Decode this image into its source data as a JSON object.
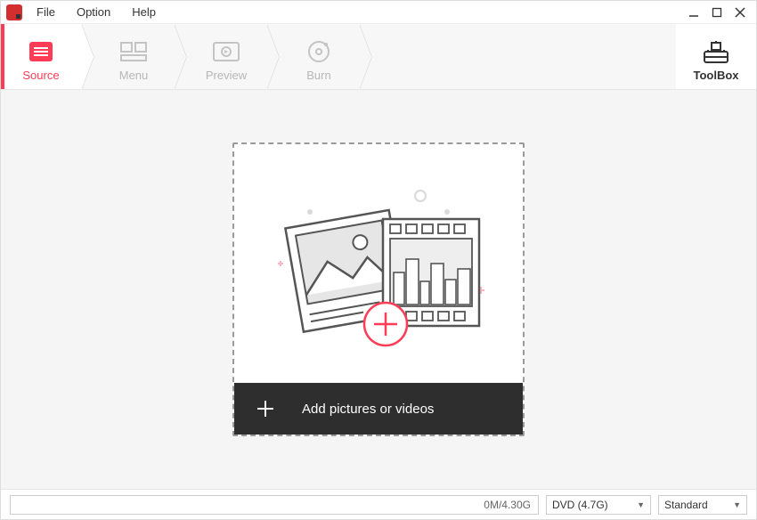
{
  "menu": {
    "file": "File",
    "option": "Option",
    "help": "Help"
  },
  "steps": {
    "source": "Source",
    "menu": "Menu",
    "preview": "Preview",
    "burn": "Burn"
  },
  "toolbox": {
    "label": "ToolBox"
  },
  "dropzone": {
    "label": "Add pictures or videos"
  },
  "status": {
    "progress": "0M/4.30G",
    "disc_select": "DVD (4.7G)",
    "quality_select": "Standard"
  }
}
